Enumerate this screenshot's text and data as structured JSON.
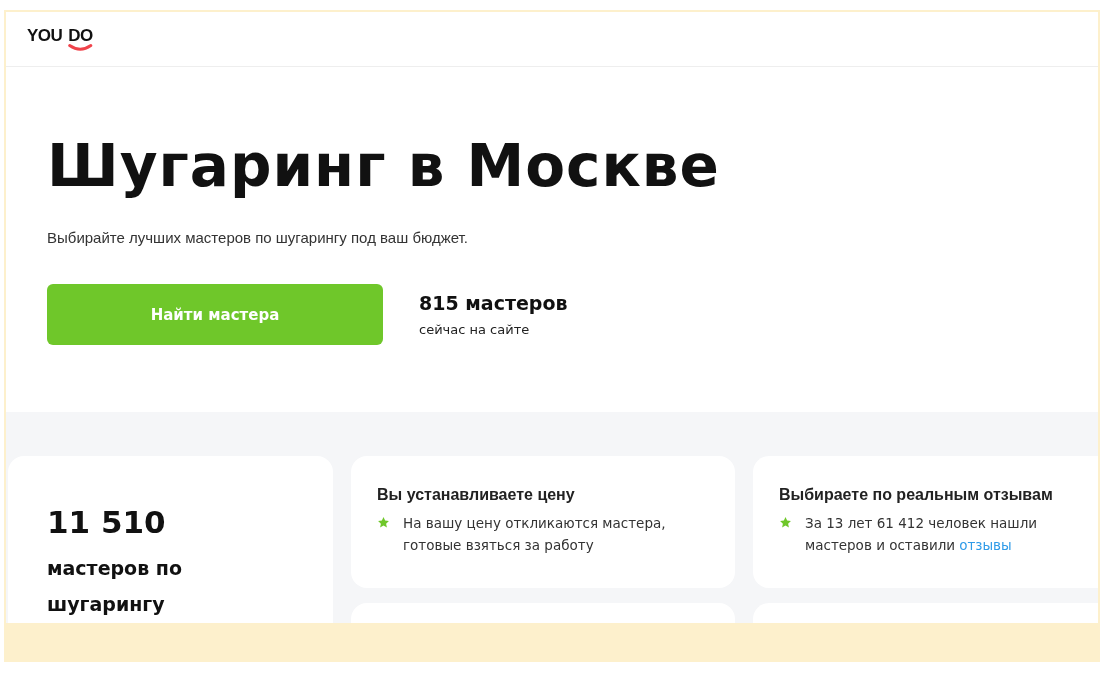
{
  "logo": {
    "left": "YOU",
    "right": "DO"
  },
  "hero": {
    "title": "Шугаринг в Москве",
    "subtitle": "Выбирайте лучших мастеров по шугарингу под ваш бюджет.",
    "button": "Найти мастера",
    "stat": {
      "value": "815 мастеров",
      "caption": "сейчас на сайте"
    }
  },
  "total": {
    "value": "11 510",
    "caption": "мастеров по шугарингу"
  },
  "features": [
    {
      "title": "Вы устанавливаете цену",
      "text": "На вашу цену откликаются мастера, готовые взяться за работу"
    },
    {
      "title": "Выбираете по реальным отзывам",
      "text": "За 13 лет 61 412 человек нашли мастеров и оставили",
      "link": "отзывы"
    }
  ]
}
